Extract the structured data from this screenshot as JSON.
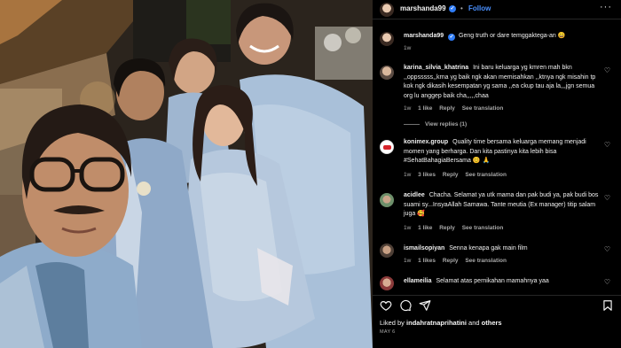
{
  "post": {
    "author": "marshanda99",
    "follow_label": "Follow",
    "dot": "•",
    "more_icon": "more-horizontal-icon",
    "verified_color": "#2f7cf6",
    "follow_color": "#4a90ff"
  },
  "caption": {
    "user": "marshanda99",
    "text": "Geng truth or dare temggaktega-an 😄",
    "time": "1w"
  },
  "comments": [
    {
      "user": "karina_silvia_khatrina",
      "text": "Ini baru keluarga yg kmren mah bkn ,,oppsssss,,krna yg baik ngk akan memisahkan ,,ktnya ngk misahin tp kok ngk dikasih kesempatan yg sama ,,ea ckup tau aja la,,,jgn semua org lu anggep baik cha,,,,,chaa",
      "time": "1w",
      "likes": "1 like",
      "reply": "Reply",
      "translate": "See translation",
      "view_replies": "View replies (1)"
    },
    {
      "user": "konimex.group",
      "text": "Quality time bersama keluarga memang menjadi momen yang berharga. Dan kita pastinya kita lebih bisa #SehatBahagiaBersama 😊 🙏",
      "time": "1w",
      "likes": "3 likes",
      "reply": "Reply",
      "translate": "See translation"
    },
    {
      "user": "acidlee",
      "text": "Chacha. Selamat ya utk mama dan pak budi ya, pak budi bos suami sy...InsyaAllah Samawa. Tante meutia (Ex manager) titip salam juga 🥰",
      "time": "1w",
      "likes": "1 like",
      "reply": "Reply",
      "translate": "See translation"
    },
    {
      "user": "ismailsopiyan",
      "text": "Senna kenapa gak main film",
      "time": "1w",
      "likes": "1 likes",
      "reply": "Reply",
      "translate": "See translation"
    },
    {
      "user": "ellameilia",
      "text": "Selamat atas pernikahan mamahnya yaa"
    }
  ],
  "footer": {
    "liked_prefix": "Liked by",
    "liked_user": "indahratnaprihatini",
    "liked_and": "and",
    "liked_others": "others",
    "date": "MAY 6"
  },
  "icons": [
    "heart-icon",
    "comment-icon",
    "share-icon",
    "bookmark-icon"
  ]
}
